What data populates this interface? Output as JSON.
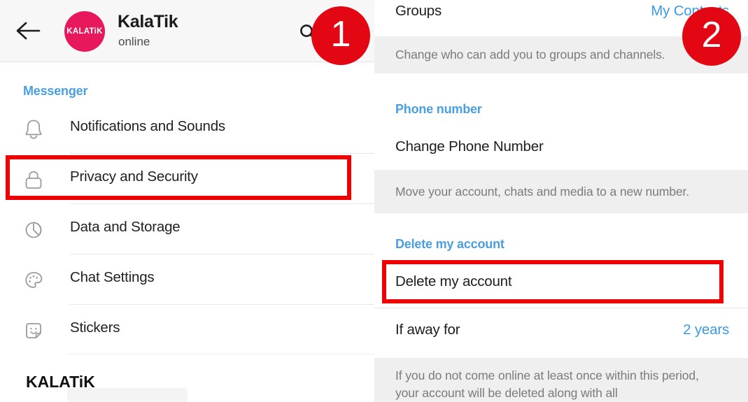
{
  "app": {
    "watermark": "KALATiK"
  },
  "left_panel": {
    "header": {
      "back_icon": "back-arrow-icon",
      "avatar_label": "KALATiK",
      "title": "KalaTik",
      "status": "online",
      "search_icon": "search-icon",
      "avatar_color": "#e8185d",
      "background": "#f7f7f7"
    },
    "section_label": "Messenger",
    "accent_color": "#4a9fe0",
    "items": [
      {
        "label": "Notifications and Sounds",
        "icon": "bell-icon"
      },
      {
        "label": "Privacy and Security",
        "icon": "lock-icon"
      },
      {
        "label": "Data and Storage",
        "icon": "pie-chart-icon"
      },
      {
        "label": "Chat Settings",
        "icon": "palette-icon"
      },
      {
        "label": "Stickers",
        "icon": "sticker-smiley-icon"
      }
    ]
  },
  "right_panel": {
    "groups_row": {
      "title": "Groups",
      "value": "My Contacts"
    },
    "groups_hint": "Change who can add you to groups and channels.",
    "phone_section_label": "Phone number",
    "change_phone_row": {
      "title": "Change Phone Number"
    },
    "change_phone_hint": "Move your account, chats and media to a new number.",
    "delete_section_label": "Delete my account",
    "delete_row": {
      "title": "Delete my account"
    },
    "if_away_row": {
      "title": "If away for",
      "value": "2 years"
    },
    "if_away_hint": "If you do not come online at least once within this period, your account will be deleted along with all"
  },
  "annotations": {
    "badges": [
      {
        "label": "1"
      },
      {
        "label": "2"
      }
    ],
    "highlight_color": "#ee0000",
    "badge_color": "#e30613"
  }
}
